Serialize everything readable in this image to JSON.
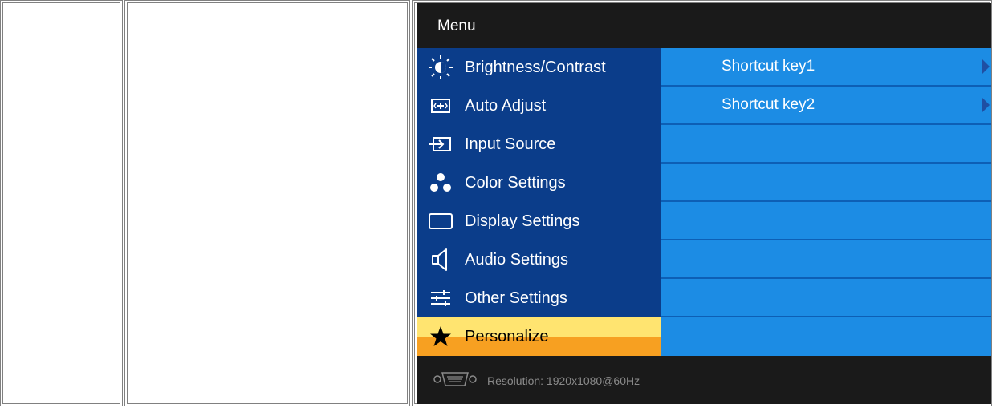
{
  "osd": {
    "title": "Menu",
    "menu_items": [
      {
        "label": "Brightness/Contrast",
        "icon": "brightness-icon"
      },
      {
        "label": "Auto Adjust",
        "icon": "auto-adjust-icon"
      },
      {
        "label": "Input Source",
        "icon": "input-source-icon"
      },
      {
        "label": "Color Settings",
        "icon": "color-settings-icon"
      },
      {
        "label": "Display Settings",
        "icon": "display-settings-icon"
      },
      {
        "label": "Audio Settings",
        "icon": "speaker-icon"
      },
      {
        "label": "Other Settings",
        "icon": "sliders-icon"
      },
      {
        "label": "Personalize",
        "icon": "star-icon",
        "selected": true
      }
    ],
    "submenu_rows": [
      {
        "label": "Shortcut key1",
        "has_arrow": true
      },
      {
        "label": "Shortcut key2",
        "has_arrow": true
      },
      {
        "label": ""
      },
      {
        "label": ""
      },
      {
        "label": ""
      },
      {
        "label": ""
      },
      {
        "label": ""
      },
      {
        "label": ""
      }
    ],
    "status": {
      "resolution_text": "Resolution:  1920x1080@60Hz",
      "connector_icon": "vga-connector-icon"
    },
    "colors": {
      "menu_bg": "#0b3d8a",
      "submenu_bg": "#1c8ce4",
      "selected_top": "#ffe470",
      "selected_bottom": "#f7a021",
      "osd_bg": "#1a1a1a"
    }
  }
}
